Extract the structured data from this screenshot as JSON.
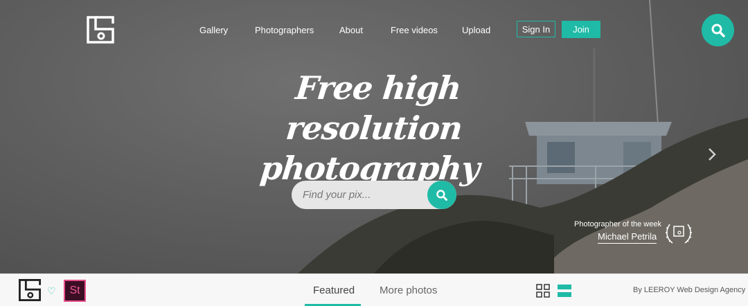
{
  "nav": {
    "links": [
      {
        "label": "Gallery"
      },
      {
        "label": "Photographers"
      },
      {
        "label": "About"
      },
      {
        "label": "Free videos"
      },
      {
        "label": "Upload"
      }
    ],
    "sign_in": "Sign In",
    "join": "Join"
  },
  "hero": {
    "headline_line1": "Free high resolution",
    "headline_line2": "photography",
    "search_placeholder": "Find your pix...",
    "photographer_caption": "Photographer of the week",
    "photographer_name": "Michael Petrila"
  },
  "bottom": {
    "stock_badge": "St",
    "tabs": [
      "Featured",
      "More photos"
    ],
    "credit": "By LEEROY Web Design Agency"
  },
  "colors": {
    "accent": "#1fbba6",
    "hero_overlay": "#5f5f5f"
  },
  "icons": [
    "logo-icon",
    "search-icon",
    "chevron-right-icon",
    "laurel-badge-icon",
    "heart-icon",
    "grid-view-icon",
    "list-view-icon"
  ]
}
